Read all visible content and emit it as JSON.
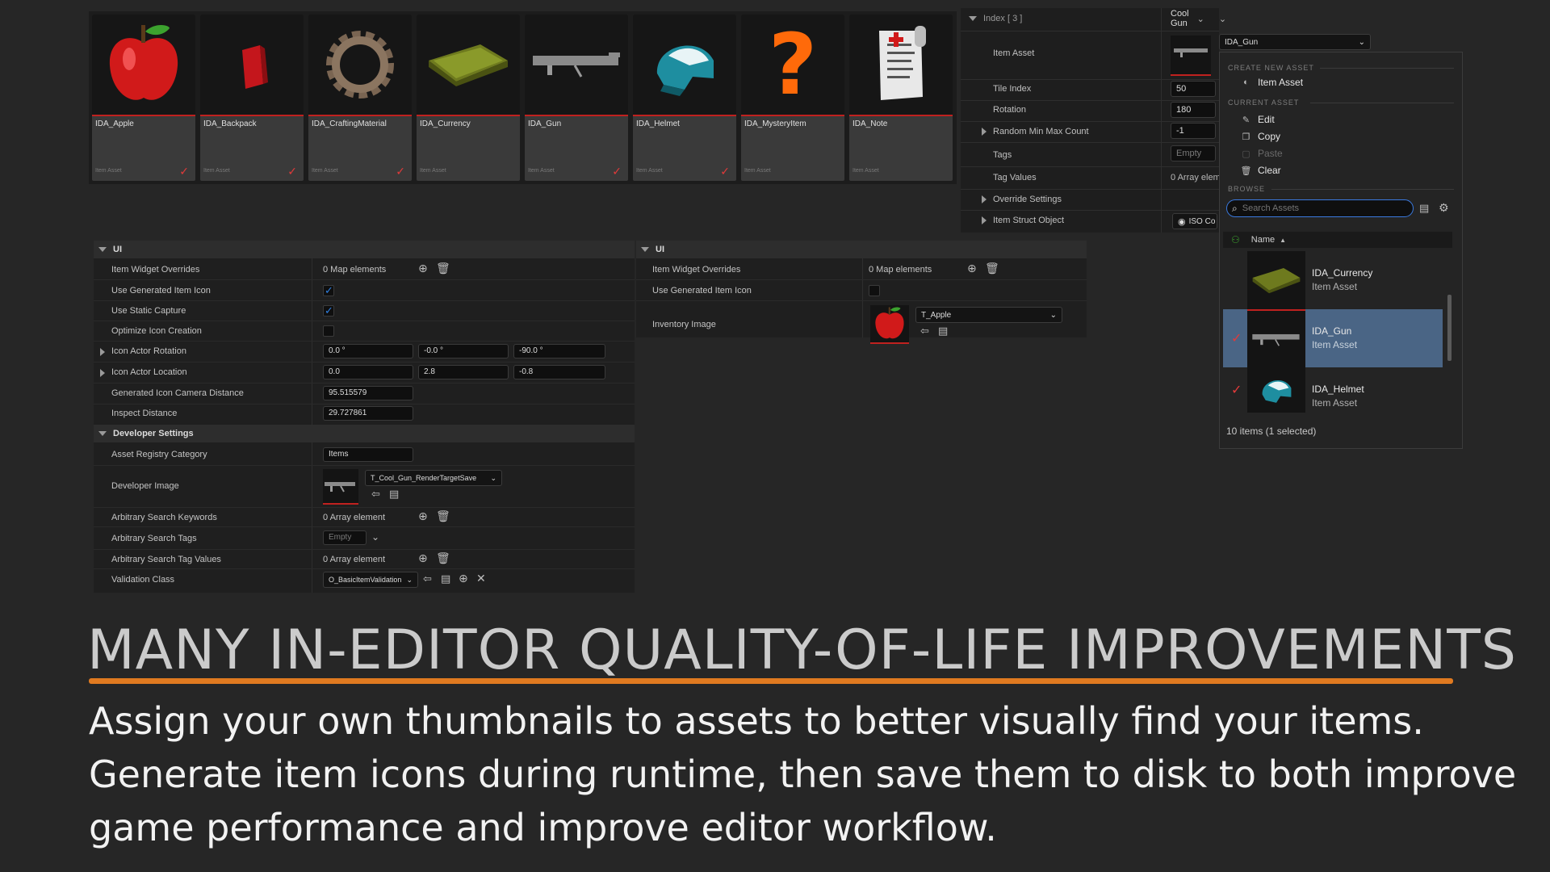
{
  "thumbnails": [
    {
      "name": "IDA_Apple",
      "type": "Item Asset",
      "icon": "apple-icon",
      "checked": true
    },
    {
      "name": "IDA_Backpack",
      "type": "Item Asset",
      "icon": "backpack-icon",
      "checked": true
    },
    {
      "name": "IDA_CraftingMaterial",
      "type": "Item Asset",
      "icon": "gear-icon",
      "checked": true
    },
    {
      "name": "IDA_Currency",
      "type": "Item Asset",
      "icon": "money-stack-icon",
      "checked": false
    },
    {
      "name": "IDA_Gun",
      "type": "Item Asset",
      "icon": "gun-icon",
      "checked": true
    },
    {
      "name": "IDA_Helmet",
      "type": "Item Asset",
      "icon": "helmet-icon",
      "checked": true
    },
    {
      "name": "IDA_MysteryItem",
      "type": "Item Asset",
      "icon": "question-mark-icon",
      "checked": false
    },
    {
      "name": "IDA_Note",
      "type": "Item Asset",
      "icon": "note-icon",
      "checked": false
    }
  ],
  "details": {
    "index_label": "Index [ 3 ]",
    "index_value": "Cool Gun",
    "item_asset_label": "Item Asset",
    "item_asset_value": "IDA_Gun",
    "tile_index_label": "Tile Index",
    "tile_index_value": "50",
    "rotation_label": "Rotation",
    "rotation_value": "180",
    "rmmc_label": "Random Min Max Count",
    "rmmc_value": "-1",
    "tags_label": "Tags",
    "tags_value": "Empty",
    "tag_values_label": "Tag Values",
    "tag_values_value": "0 Array elem",
    "override_label": "Override Settings",
    "struct_label": "Item Struct Object",
    "struct_value": "ISO Co"
  },
  "popup": {
    "create_section": "CREATE NEW ASSET",
    "create_item": "Item Asset",
    "current_section": "CURRENT ASSET",
    "edit": "Edit",
    "copy": "Copy",
    "paste": "Paste",
    "clear": "Clear",
    "browse_section": "BROWSE",
    "search_placeholder": "Search Assets",
    "column_name": "Name",
    "assets": [
      {
        "name": "IDA_Currency",
        "type": "Item Asset",
        "selected": false,
        "checked": false
      },
      {
        "name": "IDA_Gun",
        "type": "Item Asset",
        "selected": true,
        "checked": true
      },
      {
        "name": "IDA_Helmet",
        "type": "Item Asset",
        "selected": false,
        "checked": true
      }
    ],
    "footer": "10 items (1 selected)"
  },
  "left_panel": {
    "ui_header": "UI",
    "item_widget_overrides": "Item Widget Overrides",
    "item_widget_overrides_value": "0 Map elements",
    "use_generated_icon": "Use Generated Item Icon",
    "use_static_capture": "Use Static Capture",
    "optimize_icon": "Optimize Icon Creation",
    "icon_actor_rotation": "Icon Actor Rotation",
    "rot": [
      "0.0 °",
      "-0.0 °",
      "-90.0 °"
    ],
    "icon_actor_location": "Icon Actor Location",
    "loc": [
      "0.0",
      "2.8",
      "-0.8"
    ],
    "camera_distance": "Generated Icon Camera Distance",
    "camera_distance_value": "95.515579",
    "inspect_distance": "Inspect Distance",
    "inspect_distance_value": "29.727861",
    "dev_header": "Developer Settings",
    "registry_category": "Asset Registry Category",
    "registry_category_value": "Items",
    "developer_image": "Developer Image",
    "developer_image_value": "T_Cool_Gun_RenderTargetSave",
    "search_keywords": "Arbitrary Search Keywords",
    "search_keywords_value": "0 Array element",
    "search_tags": "Arbitrary Search Tags",
    "search_tags_value": "Empty",
    "search_tag_values": "Arbitrary Search Tag Values",
    "search_tag_values_value": "0 Array element",
    "validation_class": "Validation Class",
    "validation_class_value": "O_BasicItemValidation"
  },
  "mid_panel": {
    "ui_header": "UI",
    "item_widget_overrides": "Item Widget Overrides",
    "item_widget_overrides_value": "0 Map elements",
    "use_generated_icon": "Use Generated Item Icon",
    "inventory_image": "Inventory Image",
    "inventory_image_value": "T_Apple"
  },
  "headline": "MANY IN-EDITOR QUALITY-OF-LIFE IMPROVEMENTS",
  "body_lines": [
    "Assign your own thumbnails to assets to better visually find your items.",
    "Generate item icons during runtime, then save them to disk to both improve",
    "game performance and improve editor workflow."
  ],
  "colors": {
    "accent": "#e07a20",
    "check_red": "#e23a3a",
    "check_blue": "#2f7fe0",
    "selected_row": "#4a6585"
  }
}
